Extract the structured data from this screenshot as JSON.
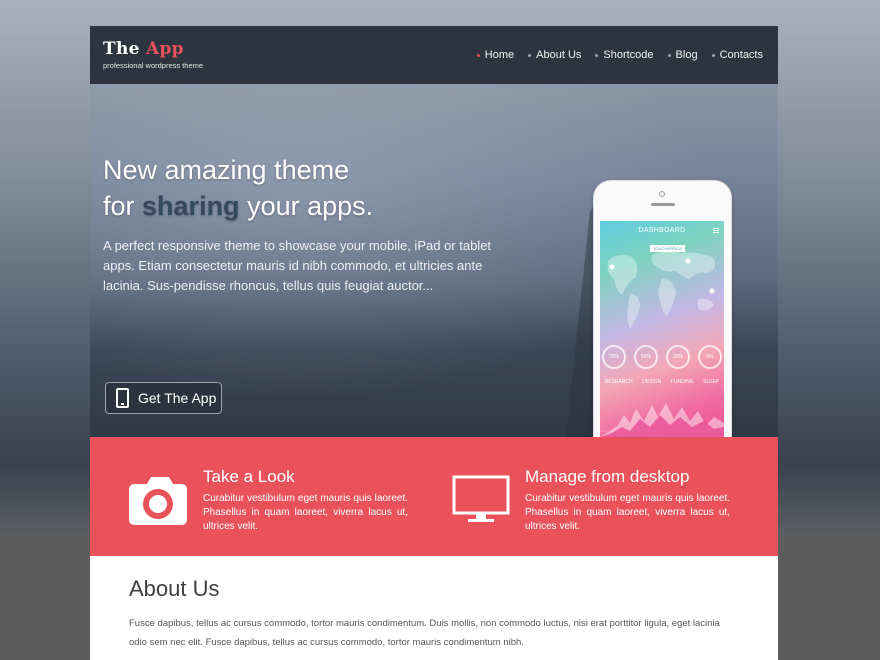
{
  "brand": {
    "title_part1": "The",
    "title_part2": "App",
    "tagline": "professional wordpress theme",
    "accent_color": "#e9525a",
    "header_bg": "#2e3340"
  },
  "nav": {
    "items": [
      {
        "label": "Home",
        "active": true
      },
      {
        "label": "About Us",
        "active": false
      },
      {
        "label": "Shortcode",
        "active": false
      },
      {
        "label": "Blog",
        "active": false
      },
      {
        "label": "Contacts",
        "active": false
      }
    ]
  },
  "hero": {
    "headline_line1": "New amazing theme",
    "headline_pre": "for",
    "headline_bold": "sharing",
    "headline_post": "your apps.",
    "body": "A perfect responsive theme to showcase your mobile, iPad or tablet apps. Etiam consectetur mauris id nibh commodo, et ultricies ante lacinia. Sus-pendisse rhoncus, tellus quis feugiat auctor...",
    "cta_label": "Get The App",
    "cta_icon": "phone-icon"
  },
  "phone_screen": {
    "title": "DASHBOARD",
    "tag": "TOUCHAPPICA",
    "rings": [
      "75%",
      "50%",
      "30%",
      "0%"
    ],
    "ring_labels": [
      "RESEARCH",
      "DESIGN",
      "FUNDING",
      "SLEEP"
    ]
  },
  "features": [
    {
      "icon": "camera-icon",
      "title": "Take a Look",
      "text": "Curabitur vestibulum eget mauris quis laoreet. Phasellus in quam laoreet, viverra lacus ut, ultrices velit."
    },
    {
      "icon": "monitor-icon",
      "title": "Manage from desktop",
      "text": "Curabitur vestibulum eget mauris quis laoreet. Phasellus in quam laoreet, viverra lacus ut, ultrices velit."
    }
  ],
  "about": {
    "title": "About Us",
    "text": "Fusce dapibus, tellus ac cursus commodo, tortor mauris condimentum. Duis mollis, non commodo luctus, nisi erat porttitor ligula, eget lacinia odio sem nec elit. Fusce dapibus, tellus ac cursus commodo, tortor mauris condimentum nibh."
  }
}
